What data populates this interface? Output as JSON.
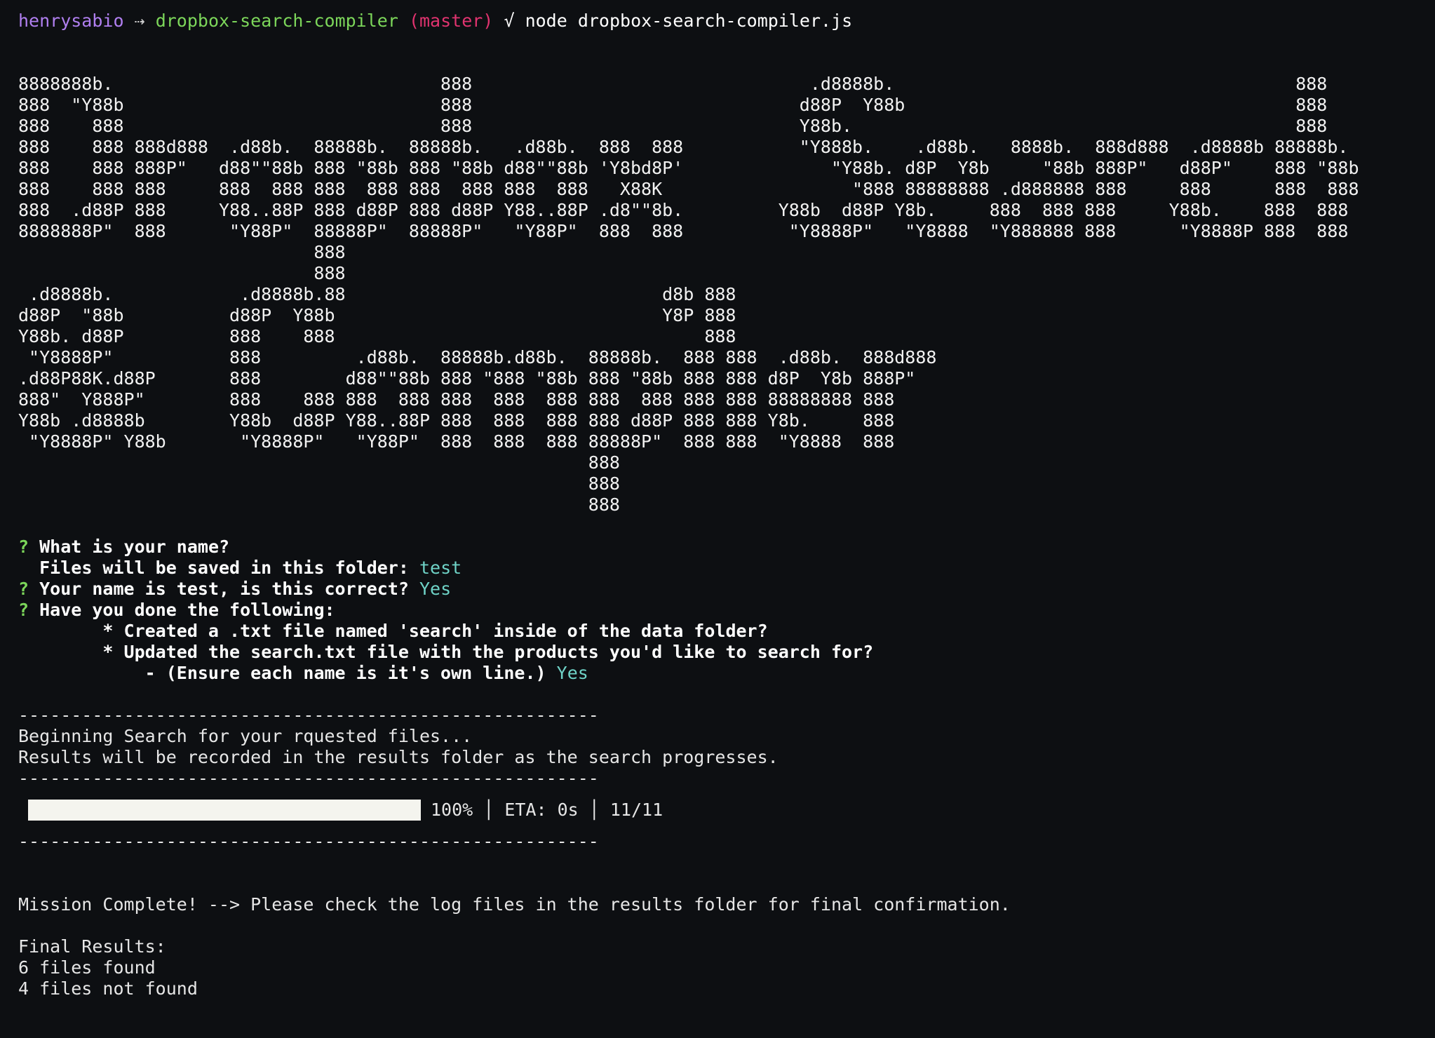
{
  "prompt": {
    "user": "henrysabio",
    "arrow": "⇢",
    "repo": "dropbox-search-compiler",
    "branch": "(master)",
    "status": "√",
    "command": "node dropbox-search-compiler.js"
  },
  "banner": {
    "block1": "8888888b.                               888                                .d8888b.                                      888\n888  \"Y88b                              888                               d88P  Y88b                                     888\n888    888                              888                               Y88b.                                          888\n888    888 888d888  .d88b.  88888b.  88888b.   .d88b.  888  888           \"Y888b.    .d88b.   8888b.  888d888  .d8888b 88888b.\n888    888 888P\"   d88\"\"88b 888 \"88b 888 \"88b d88\"\"88b 'Y8bd8P'              \"Y88b. d8P  Y8b     \"88b 888P\"   d88P\"    888 \"88b\n888    888 888     888  888 888  888 888  888 888  888   X88K                  \"888 88888888 .d888888 888     888      888  888\n888  .d88P 888     Y88..88P 888 d88P 888 d88P Y88..88P .d8\"\"8b.         Y88b  d88P Y8b.     888  888 888     Y88b.    888  888\n8888888P\"  888      \"Y88P\"  88888P\"  88888P\"   \"Y88P\"  888  888          \"Y8888P\"   \"Y8888  \"Y888888 888      \"Y8888P 888  888\n                            888\n                            888",
    "block2": " .d8888b.            .d8888b.88                              d8b 888\nd88P  \"88b          d88P  Y88b                               Y8P 888\nY88b. d88P          888    888                                   888\n \"Y8888P\"           888         .d88b.  88888b.d88b.  88888b.  888 888  .d88b.  888d888\n.d88P88K.d88P       888        d88\"\"88b 888 \"888 \"88b 888 \"88b 888 888 d8P  Y8b 888P\"\n888\"  Y888P\"        888    888 888  888 888  888  888 888  888 888 888 88888888 888\nY88b .d8888b        Y88b  d88P Y88..88P 888  888  888 888 d88P 888 888 Y8b.     888\n \"Y8888P\" Y88b       \"Y8888P\"   \"Y88P\"  888  888  888 88888P\"  888 888  \"Y8888  888\n                                                      888\n                                                      888\n                                                      888"
  },
  "questions": {
    "mark": "?",
    "name_question": "What is your name?",
    "folder_label": "Files will be saved in this folder:",
    "folder_value": "test",
    "confirm_question": "Your name is test, is this correct?",
    "confirm_answer": "Yes",
    "checklist_question": "Have you done the following:",
    "checklist_item1": "* Created a .txt file named 'search' inside of the data folder?",
    "checklist_item2": "* Updated the search.txt file with the products you'd like to search for?",
    "checklist_item3": "- (Ensure each name is it's own line.)",
    "checklist_answer": "Yes"
  },
  "log": {
    "separator": "-------------------------------------------------------",
    "begin": "Beginning Search for your rquested files...",
    "results_note": "Results will be recorded in the results folder as the search progresses.",
    "progress_fraction": 1.0,
    "progress_text": "100% │ ETA: 0s │ 11/11",
    "mission": "Mission Complete! --> Please check the log files in the results folder for final confirmation.",
    "final_header": "Final Results:",
    "found": "6 files found",
    "not_found": "4 files not found"
  },
  "colors": {
    "background": "#0d0f12",
    "user": "#b07ff0",
    "repo": "#7cd65a",
    "branch": "#e0336f",
    "answer": "#6fd3c7",
    "progress_fill": "#f4f4ee"
  }
}
